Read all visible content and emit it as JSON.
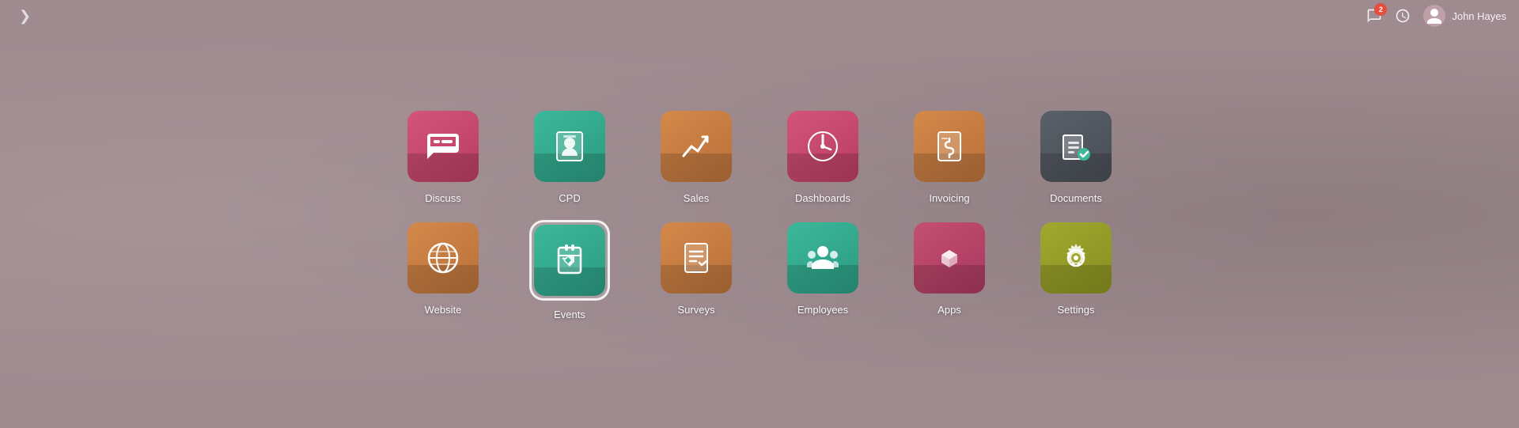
{
  "topbar": {
    "menu_icon": "›",
    "chat_count": "2",
    "user_name": "John Hayes"
  },
  "apps": [
    {
      "id": "discuss",
      "label": "Discuss",
      "color_class": "icon-discuss",
      "selected": false,
      "row": 1
    },
    {
      "id": "cpd",
      "label": "CPD",
      "color_class": "icon-cpd",
      "selected": false,
      "row": 1
    },
    {
      "id": "sales",
      "label": "Sales",
      "color_class": "icon-sales",
      "selected": false,
      "row": 1
    },
    {
      "id": "dashboards",
      "label": "Dashboards",
      "color_class": "icon-dashboards",
      "selected": false,
      "row": 1
    },
    {
      "id": "invoicing",
      "label": "Invoicing",
      "color_class": "icon-invoicing",
      "selected": false,
      "row": 1
    },
    {
      "id": "documents",
      "label": "Documents",
      "color_class": "icon-documents",
      "selected": false,
      "row": 1
    },
    {
      "id": "website",
      "label": "Website",
      "color_class": "icon-website",
      "selected": false,
      "row": 2
    },
    {
      "id": "events",
      "label": "Events",
      "color_class": "icon-events",
      "selected": true,
      "row": 2
    },
    {
      "id": "surveys",
      "label": "Surveys",
      "color_class": "icon-surveys",
      "selected": false,
      "row": 2
    },
    {
      "id": "employees",
      "label": "Employees",
      "color_class": "icon-employees",
      "selected": false,
      "row": 2
    },
    {
      "id": "apps",
      "label": "Apps",
      "color_class": "icon-apps",
      "selected": false,
      "row": 2
    },
    {
      "id": "settings",
      "label": "Settings",
      "color_class": "icon-settings",
      "selected": false,
      "row": 2
    }
  ]
}
